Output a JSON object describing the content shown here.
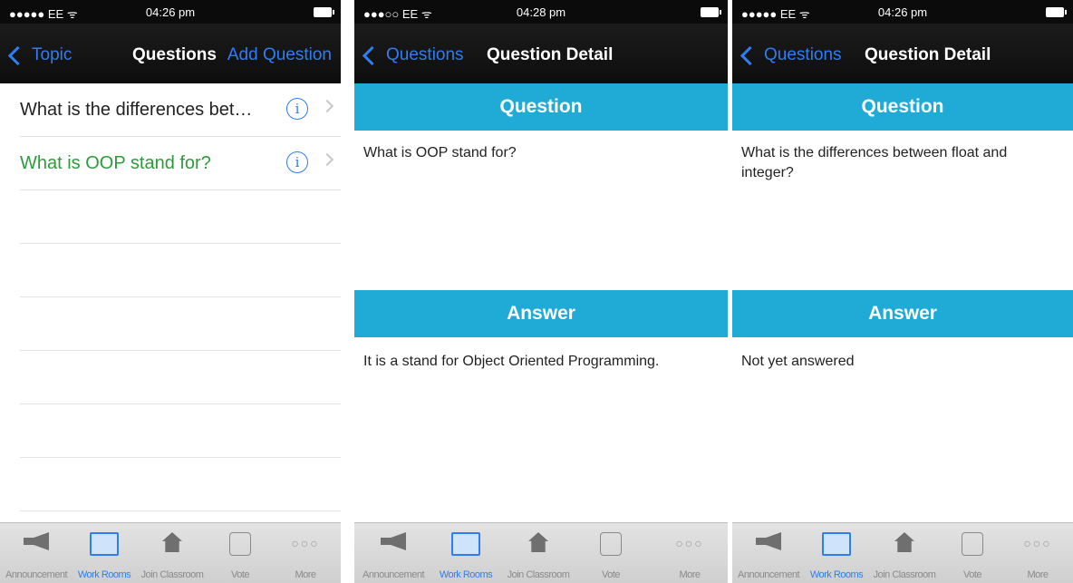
{
  "screens": [
    {
      "status": {
        "carrier": "●●●●● EE ᯤ",
        "time": "04:26 pm"
      },
      "nav": {
        "back": "Topic",
        "title": "Questions",
        "action": "Add Question"
      },
      "list": [
        {
          "text": "What is the differences bet…"
        },
        {
          "text": "What is OOP stand for?"
        }
      ]
    },
    {
      "status": {
        "carrier": "●●●○○ EE ᯤ",
        "time": "04:28 pm"
      },
      "nav": {
        "back": "Questions",
        "title": "Question Detail"
      },
      "question_header": "Question",
      "question": "What is OOP stand for?",
      "answer_header": "Answer",
      "answer": "It is a stand for Object Oriented Programming."
    },
    {
      "status": {
        "carrier": "●●●●● EE ᯤ",
        "time": "04:26 pm"
      },
      "nav": {
        "back": "Questions",
        "title": "Question Detail"
      },
      "question_header": "Question",
      "question": "What is the differences between float and integer?",
      "answer_header": "Answer",
      "answer": "Not yet answered"
    }
  ],
  "tabbar": {
    "items": [
      {
        "label": "Announcement",
        "icon": "megaphone-icon"
      },
      {
        "label": "Work Rooms",
        "icon": "whiteboard-icon",
        "active": true
      },
      {
        "label": "Join Classroom",
        "icon": "house-icon"
      },
      {
        "label": "Vote",
        "icon": "thumbs-up-icon"
      },
      {
        "label": "More",
        "icon": "more-icon"
      }
    ]
  },
  "colors": {
    "accent": "#2f7df3",
    "band": "#20abd6",
    "green_text": "#2e9b3b",
    "navbar": "#111111"
  }
}
